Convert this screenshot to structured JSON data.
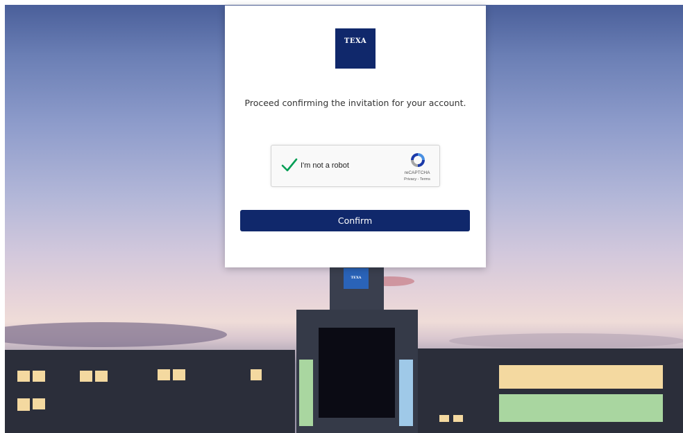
{
  "card": {
    "logo_text": "TEXA",
    "message": "Proceed confirming the invitation for your account.",
    "confirm_label": "Confirm"
  },
  "recaptcha": {
    "label": "I'm not a robot",
    "brand": "reCAPTCHA",
    "links": "Privacy - Terms",
    "checked": true
  },
  "background": {
    "building_sign": "TEXA"
  },
  "colors": {
    "brand_navy": "#10286b",
    "check_green": "#009e55"
  }
}
